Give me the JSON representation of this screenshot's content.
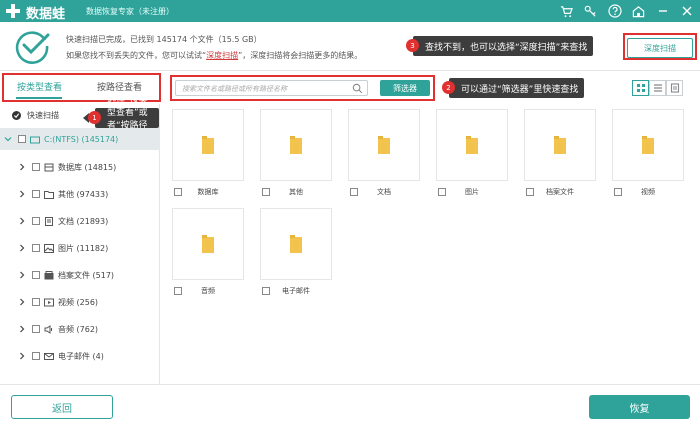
{
  "app": {
    "name": "数据蛙",
    "edition": "数据恢复专家（未注册）"
  },
  "summary": {
    "line1": "快速扫描已完成，已找到 145174 个文件（15.5 GB）",
    "line2_prefix": "如果您找不到丢失的文件，您可以试试“",
    "line2_link": "深度扫描",
    "line2_suffix": "”，深度扫描将会扫描更多的结果。",
    "deep_scan_button": "深度扫描"
  },
  "tabs": {
    "by_type": "按类型查看",
    "by_path": "按路径查看"
  },
  "filter": {
    "search_placeholder": "搜索文件名或路径或所有路径名称",
    "filter_button": "筛选器"
  },
  "callouts": [
    {
      "num": "1",
      "text": "选择“按类型查看”或者“按路径查看”"
    },
    {
      "num": "2",
      "text": "可以通过“筛选器”里快速查找"
    },
    {
      "num": "3",
      "text": "查找不到，也可以选择“深度扫描”来查找"
    }
  ],
  "tree": {
    "root_label": "快速扫描",
    "drive_label": "C:(NTFS) (145174)",
    "items": [
      {
        "label": "数据库 (14815)",
        "icon": "database-icon"
      },
      {
        "label": "其他 (97433)",
        "icon": "folder-icon"
      },
      {
        "label": "文档 (21893)",
        "icon": "document-icon"
      },
      {
        "label": "图片 (11182)",
        "icon": "image-icon"
      },
      {
        "label": "档案文件 (517)",
        "icon": "archive-icon"
      },
      {
        "label": "视频 (256)",
        "icon": "video-icon"
      },
      {
        "label": "音频 (762)",
        "icon": "audio-icon"
      },
      {
        "label": "电子邮件 (4)",
        "icon": "email-icon"
      }
    ]
  },
  "grid": {
    "items": [
      {
        "label": "数据库"
      },
      {
        "label": "其他"
      },
      {
        "label": "文档"
      },
      {
        "label": "图片"
      },
      {
        "label": "档案文件"
      },
      {
        "label": "视频"
      },
      {
        "label": "音频"
      },
      {
        "label": "电子邮件"
      }
    ]
  },
  "footer": {
    "back_button": "返回",
    "recover_button": "恢复"
  },
  "colors": {
    "accent": "#2fa39a",
    "annotation_red": "#e03030",
    "folder_yellow": "#f2c44d"
  }
}
